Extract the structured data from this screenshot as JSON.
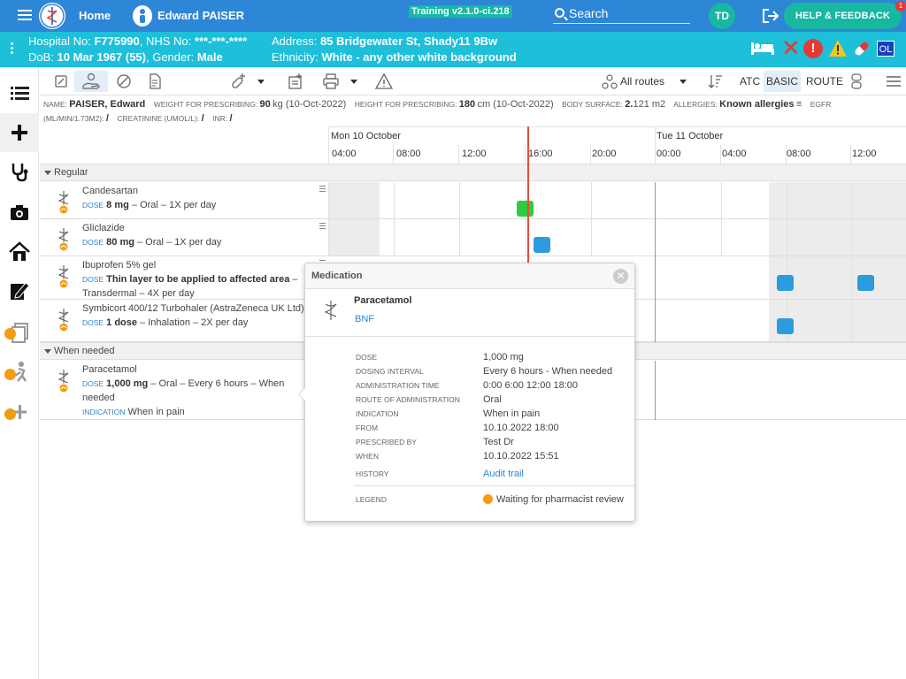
{
  "topbar": {
    "home_label": "Home",
    "patient_name": "Edward PAISER",
    "version": "Training v2.1.0-ci.218",
    "search_label": "Search",
    "user_initials": "TD",
    "help_label": "HELP & FEEDBACK",
    "help_badge": "1"
  },
  "banner": {
    "hospital_label": "Hospital No:",
    "hospital_no": "F775990",
    "nhs_label": ", NHS No:",
    "nhs_no": "***-***-****",
    "dob_label": "DoB:",
    "dob": "10 Mar 1967 (55)",
    "gender_label": ", Gender:",
    "gender": "Male",
    "address_label": "Address:",
    "address": "85 Bridgewater St, Shady11 9Bw",
    "ethnicity_label": "Ethnicity:",
    "ethnicity": "White - any other white background",
    "ol_label": "OL"
  },
  "toolbar": {
    "routes_label": "All routes",
    "atc_label": "ATC",
    "basic_label": "BASIC",
    "route_label": "ROUTE"
  },
  "info": {
    "name_label": "Name:",
    "name": "PAISER, Edward",
    "weight_label": "Weight for prescribing:",
    "weight": "90",
    "weight_unit": "kg (10-Oct-2022)",
    "height_label": "Height for prescribing:",
    "height": "180",
    "height_unit": "cm (10-Oct-2022)",
    "surface_label": "Body surface:",
    "surface": "2.",
    "surface_rest": "121 m2",
    "allergies_label": "Allergies:",
    "allergies": "Known allergies",
    "egfr_label": "eGFR",
    "egfr_unit_label": "(ml/min/1.73m2):",
    "egfr_value": "/",
    "creatinine_label": "Creatinine (umol/L):",
    "creatinine_value": "/",
    "inr_label": "INR:",
    "inr_value": "/"
  },
  "timeline": {
    "day1": "Mon 10 October",
    "day2": "Tue 11 October",
    "hours": [
      "04:00",
      "08:00",
      "12:00",
      "16:00",
      "20:00",
      "00:00",
      "04:00",
      "08:00",
      "12:00"
    ]
  },
  "sections": {
    "regular": "Regular",
    "when_needed": "When needed"
  },
  "meds": [
    {
      "name": "Candesartan",
      "dose_label": "DOSE",
      "dose": "8 mg",
      "rest": " – Oral – 1X per day"
    },
    {
      "name": "Gliclazide",
      "dose_label": "DOSE",
      "dose": "80 mg",
      "rest": " – Oral – 1X per day"
    },
    {
      "name": "Ibuprofen 5% gel",
      "dose_label": "DOSE",
      "dose": "Thin layer to be applied to affected area",
      "rest": " – Transdermal – 4X per day"
    },
    {
      "name": "Symbicort 400/12 Turbohaler (AstraZeneca UK Ltd)",
      "dose_label": "DOSE",
      "dose": "1 dose",
      "rest": " – Inhalation – 2X per day"
    },
    {
      "name": "Paracetamol",
      "dose_label": "DOSE",
      "dose": "1,000 mg",
      "rest": " – Oral – Every 6 hours – When needed",
      "indication_label": "INDICATION",
      "indication": "When in pain"
    }
  ],
  "popup": {
    "title": "Medication",
    "drug": "Paracetamol",
    "bnf": "BNF",
    "fields": [
      {
        "k": "DOSE",
        "v": "1,000 mg"
      },
      {
        "k": "DOSING INTERVAL",
        "v": "Every 6 hours - When needed"
      },
      {
        "k": "ADMINISTRATION TIME",
        "v": "0:00 6:00 12:00 18:00"
      },
      {
        "k": "ROUTE OF ADMINISTRATION",
        "v": "Oral"
      },
      {
        "k": "INDICATION",
        "v": "When in pain"
      },
      {
        "k": "FROM",
        "v": "10.10.2022 18:00"
      },
      {
        "k": "PRESCRIBED BY",
        "v": "Test Dr"
      },
      {
        "k": "WHEN",
        "v": "10.10.2022 15:51"
      }
    ],
    "history_label": "HISTORY",
    "history_link": "Audit trail",
    "legend_label": "LEGEND",
    "legend_text": "Waiting for pharmacist review"
  },
  "colors": {
    "topbar": "#2d86d6",
    "banner": "#1dbfd9",
    "accent": "#18b7a2",
    "given": "#2ecc40",
    "planned": "#2d9be0",
    "pending": "#f39c12",
    "now_line": "#e74c3c"
  }
}
